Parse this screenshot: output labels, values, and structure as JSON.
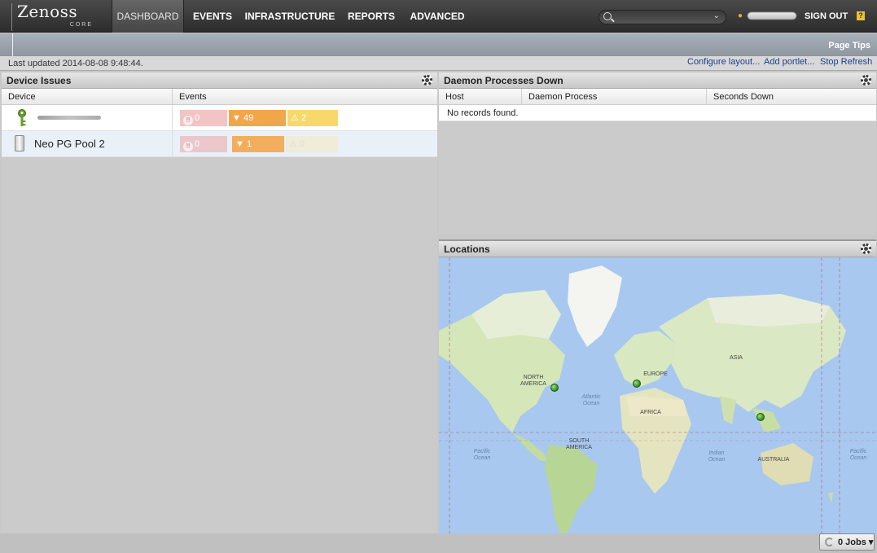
{
  "logo": {
    "name": "Zenoss",
    "edition": "CORE"
  },
  "nav": {
    "items": [
      {
        "label": "DASHBOARD"
      },
      {
        "label": "EVENTS"
      },
      {
        "label": "INFRASTRUCTURE"
      },
      {
        "label": "REPORTS"
      },
      {
        "label": "ADVANCED"
      }
    ],
    "signout": "SIGN OUT",
    "help": "?"
  },
  "subbar": {
    "page_tips": "Page Tips"
  },
  "infobar": {
    "last_updated": "Last updated 2014-08-08 9:48:44.",
    "configure_layout": "Configure layout...",
    "add_portlet": "Add portlet...",
    "stop_refresh": "Stop Refresh"
  },
  "device_issues": {
    "title": "Device Issues",
    "columns": [
      "Device",
      "Events"
    ],
    "rows": [
      {
        "device": "",
        "critical": "0",
        "error": "49",
        "warning": "2"
      },
      {
        "device": "Neo PG Pool 2",
        "critical": "0",
        "error": "1",
        "warning": "0"
      }
    ]
  },
  "daemons": {
    "title": "Daemon Processes Down",
    "columns": [
      "Host",
      "Daemon Process",
      "Seconds Down"
    ],
    "empty": "No records found."
  },
  "locations": {
    "title": "Locations",
    "labels": {
      "north_america": "NORTH AMERICA",
      "europe": "EUROPE",
      "asia": "ASIA",
      "africa": "AFRICA",
      "south_america": "SOUTH AMERICA",
      "australia": "AUSTRALIA",
      "atlantic": "Atlantic Ocean",
      "pacific_left": "Pacific Ocean",
      "indian": "Indian Ocean",
      "pacific_right": "Pacific Ocean"
    },
    "pin_count": 3
  },
  "footer": {
    "jobs": "0 Jobs ▾"
  },
  "colors": {
    "critical": "#e8a9a9",
    "error": "#f2a64a",
    "warning": "#f5d964",
    "link": "#1a3e8c"
  }
}
